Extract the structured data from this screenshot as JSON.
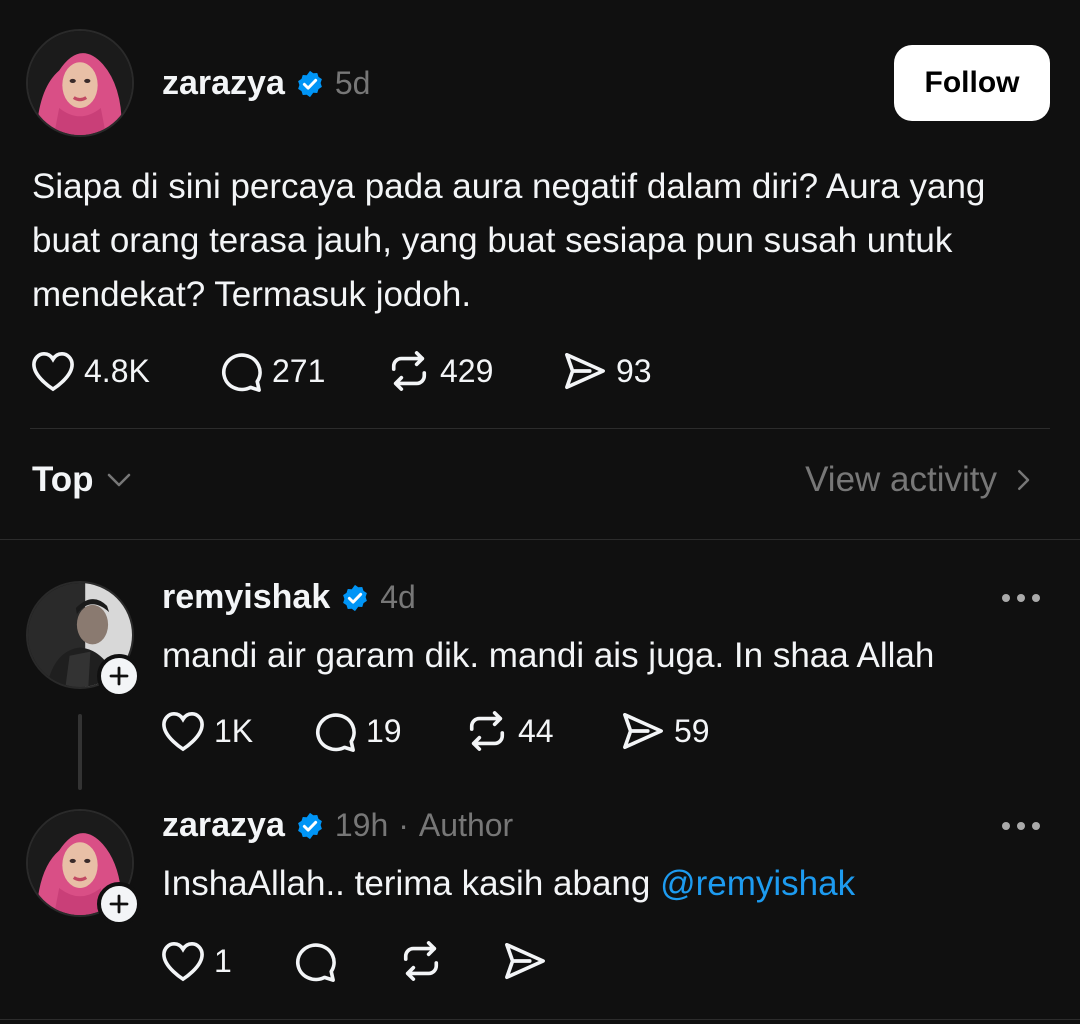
{
  "post": {
    "author": "zarazya",
    "time": "5d",
    "follow_label": "Follow",
    "text": "Siapa di sini percaya pada aura negatif dalam diri? Aura yang buat orang terasa jauh, yang buat sesiapa pun susah untuk mendekat? Termasuk jodoh.",
    "likes": "4.8K",
    "comments": "271",
    "reposts": "429",
    "shares": "93"
  },
  "sort": {
    "label": "Top",
    "view_activity": "View activity"
  },
  "replies": [
    {
      "author": "remyishak",
      "time": "4d",
      "text": "mandi air garam dik. mandi ais juga. In shaa Allah",
      "likes": "1K",
      "comments": "19",
      "reposts": "44",
      "shares": "59"
    },
    {
      "author": "zarazya",
      "time": "19h",
      "separator": "·",
      "author_tag": "Author",
      "text_prefix": "InshaAllah.. terima kasih abang ",
      "mention": "@remyishak",
      "likes": "1"
    }
  ],
  "colors": {
    "background": "#101010",
    "text": "#f3f5f7",
    "muted": "#777777",
    "verified": "#0095f6",
    "mention": "#1d9bf0"
  }
}
